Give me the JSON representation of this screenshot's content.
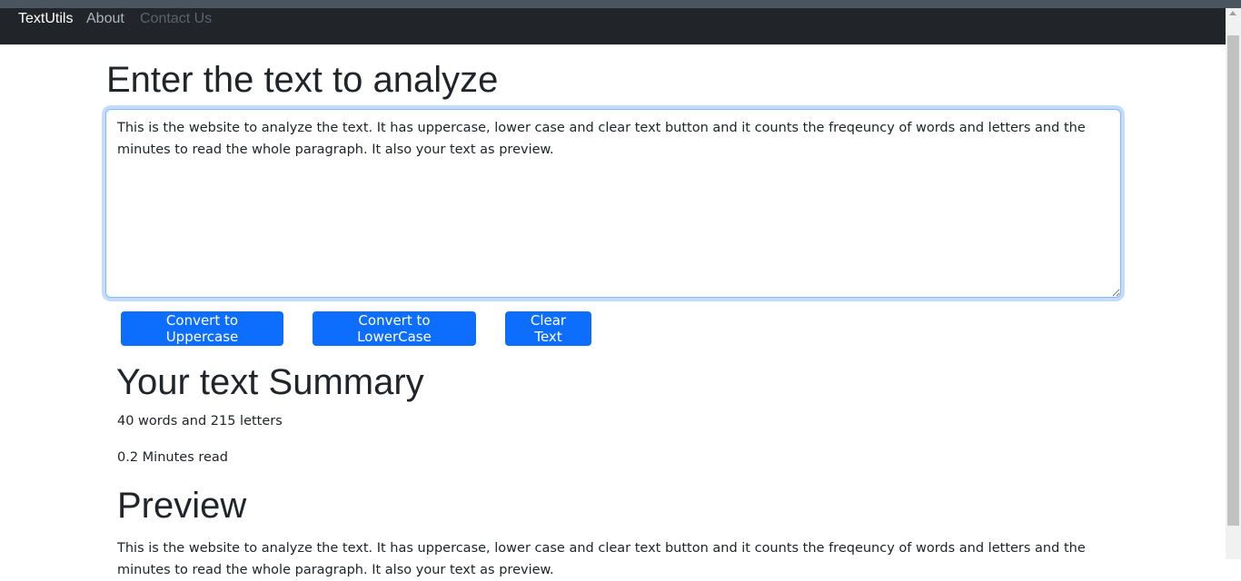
{
  "nav": {
    "brand": "TextUtils",
    "about": "About",
    "contact": "Contact Us"
  },
  "main": {
    "heading": "Enter the text to analyze",
    "textarea_value": "This is the website to analyze the text. It has uppercase, lower case and clear text button and it counts the freqeuncy of words and letters and the minutes to read the whole paragraph. It also your text as preview.",
    "buttons": {
      "uppercase": "Convert to Uppercase",
      "lowercase": "Convert to LowerCase",
      "clear": "Clear Text"
    }
  },
  "summary": {
    "heading": "Your text Summary",
    "counts": "40 words and 215 letters",
    "minutes": "0.2 Minutes read"
  },
  "preview": {
    "heading": "Preview",
    "text": "This is the website to analyze the text. It has uppercase, lower case and clear text button and it counts the freqeuncy of words and letters and the minutes to read the whole paragraph. It also your text as preview."
  },
  "colors": {
    "navbar": "#212529",
    "primary": "#0d6efd",
    "focus_border": "#86b7fe"
  }
}
